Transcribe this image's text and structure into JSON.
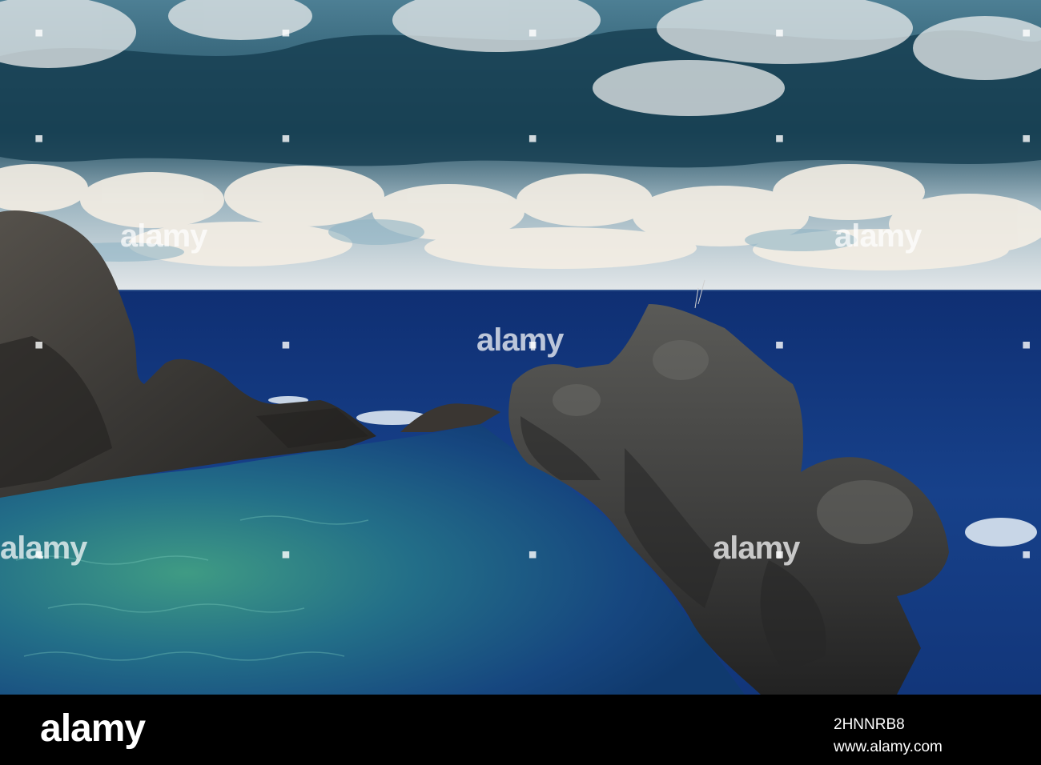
{
  "watermark": {
    "text": "alamy"
  },
  "footer": {
    "brand": "alamy",
    "image_id": "2HNNRB8",
    "url": "www.alamy.com"
  },
  "colors": {
    "sky_dark": "#1e4a5e",
    "sky_light": "#d7dde0",
    "sea_deep": "#16347a",
    "sea_mid": "#1d58a0",
    "pool_green": "#2f8a78",
    "rock": "#3a3835",
    "rock_shadow": "#1f1e1c",
    "bar": "#000000"
  }
}
